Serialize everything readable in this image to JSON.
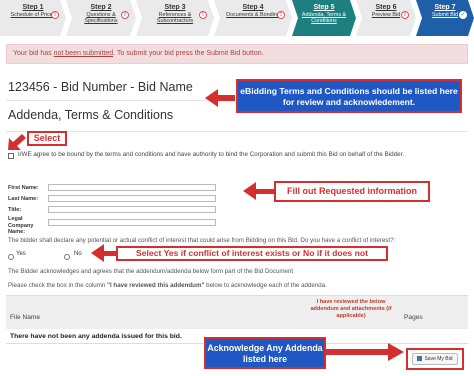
{
  "steps": [
    {
      "num": "Step 1",
      "label": "Schedule of Prices",
      "status": "warn"
    },
    {
      "num": "Step 2",
      "label": "Questions & Specifications",
      "status": "warn"
    },
    {
      "num": "Step 3",
      "label": "References & Subcontractors",
      "status": "warn"
    },
    {
      "num": "Step 4",
      "label": "Documents & Bonding",
      "status": "warn"
    },
    {
      "num": "Step 5",
      "label": "Addenda, Terms & Conditions",
      "status": "current"
    },
    {
      "num": "Step 6",
      "label": "Preview Bid",
      "status": "warn"
    },
    {
      "num": "Step 7",
      "label": "Submit Bid",
      "status": "ok"
    }
  ],
  "alert": {
    "part1": "Your bid has ",
    "underlined": "not been submitted",
    "part2": ". To submit your bid press the Submit Bid button."
  },
  "bid_title": "123456 - Bid Number - Bid Name",
  "section_title": "Addenda, Terms & Conditions",
  "agreement_text": "I/WE agree to be bound by the terms and conditions and have authority to bind the Corporation and submit this Bid on behalf of the Bidder.",
  "form": {
    "first_name": "First Name:",
    "last_name": "Last Name:",
    "title": "Title:",
    "legal_company": "Legal Company Name:"
  },
  "conflict_question": "The bidder shall declare any potential or actual conflict of interest that could arise from Bidding on this Bid. Do you have a conflict of interest?:",
  "radio_yes": "Yes",
  "radio_no": "No",
  "addendum_ack": "The Bidder acknowledges and agrees that the addendum/addenda below form part of the Bid Document",
  "check_instruction_pre": "Please check the box in the column ",
  "check_instruction_bold": "\"I have reviewed this addendum\"",
  "check_instruction_post": " below to acknowledge each of the addenda.",
  "table": {
    "col_file": "File Name",
    "col_reviewed": "I have reviewed the below addendum and attachments (if applicable)",
    "col_pages": "Pages",
    "empty_row": "There have not been any addenda issued for this bid."
  },
  "save_button": "Save My Bid",
  "annotations": {
    "terms": "eBidding Terms and Conditions should be listed here for review and acknowledement.",
    "select": "Select",
    "fill": "Fill out Requested information",
    "conflict": "Select Yes if conflict of interest exists or No if it does not",
    "acknowledge": "Acknowledge Any Addenda listed here"
  },
  "colors": {
    "step_current": "#1d7f80",
    "step_submit": "#1f5fa8",
    "alert_bg": "#f2dede",
    "annotation_red": "#d32f2f",
    "annotation_blue": "#1f57c3"
  }
}
